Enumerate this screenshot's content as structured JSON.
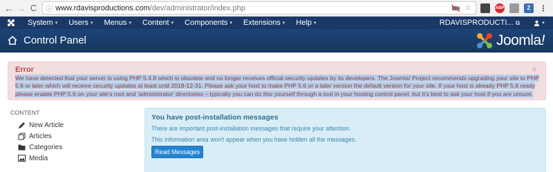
{
  "browser": {
    "url_host": "www.rdavisproductions.com",
    "url_path": "/dev/administrator/index.php",
    "nav_back": "←",
    "nav_forward": "→",
    "nav_reload": "C",
    "extensions": [
      "ext-dark",
      "adblock",
      "ext-grey",
      "zotero",
      "menu"
    ],
    "ext_labels": {
      "e2": "ABP",
      "e4": "Z",
      "e5": "⋮"
    }
  },
  "menubar": {
    "items": [
      {
        "label": "System"
      },
      {
        "label": "Users"
      },
      {
        "label": "Menus"
      },
      {
        "label": "Content"
      },
      {
        "label": "Components"
      },
      {
        "label": "Extensions"
      },
      {
        "label": "Help"
      }
    ],
    "site_name": "RDAVISPRODUCTI...",
    "ext_link_glyph": "⧉",
    "user_glyph": "👤",
    "caret_glyph": "▾"
  },
  "header": {
    "title": "Control Panel",
    "logo_text": "Joomla",
    "logo_excl": "!"
  },
  "alert": {
    "heading": "Error",
    "close": "×",
    "message": "We have detected that your server is using PHP 5.4.8 which is obsolete and no longer receives official security updates by its developers. The Joomla! Project recommends upgrading your site to PHP 5.6 or later which will receive security updates at least until 2018-12-31. Please ask your host to make PHP 5.6 or a later version the default version for your site. If your host is already PHP 5.6 ready please enable PHP 5.6 on your site's root and 'administrator' directories – typically you can do this yourself through a tool in your hosting control panel, but it's best to ask your host if you are unsure."
  },
  "sidebar": {
    "heading": "CONTENT",
    "items": [
      {
        "label": "New Article",
        "icon": "pencil-icon"
      },
      {
        "label": "Articles",
        "icon": "stack-icon"
      },
      {
        "label": "Categories",
        "icon": "folder-icon"
      },
      {
        "label": "Media",
        "icon": "image-icon"
      }
    ]
  },
  "postinstall": {
    "title": "You have post-installation messages",
    "text1": "There are important post-installation messages that require your attention.",
    "text2": "This information area won't appear when you have hidden all the messages.",
    "button": "Read Messages"
  },
  "colors": {
    "menubar": "#1a3867",
    "header": "#1d4478",
    "alert_bg": "#f2dede",
    "info_bg": "#d9edf7",
    "button": "#2384d3"
  }
}
